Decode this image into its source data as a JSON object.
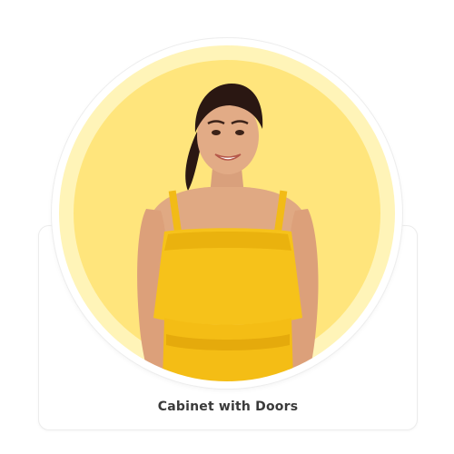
{
  "product": {
    "title": "Cabinet with Doors",
    "image_alt": "woman-in-yellow-top-photo"
  },
  "colors": {
    "circle_outer": "#fff4b8",
    "circle_inner": "#ffe57c",
    "garment": "#f6c21a",
    "label_text": "#3a3a3a"
  }
}
